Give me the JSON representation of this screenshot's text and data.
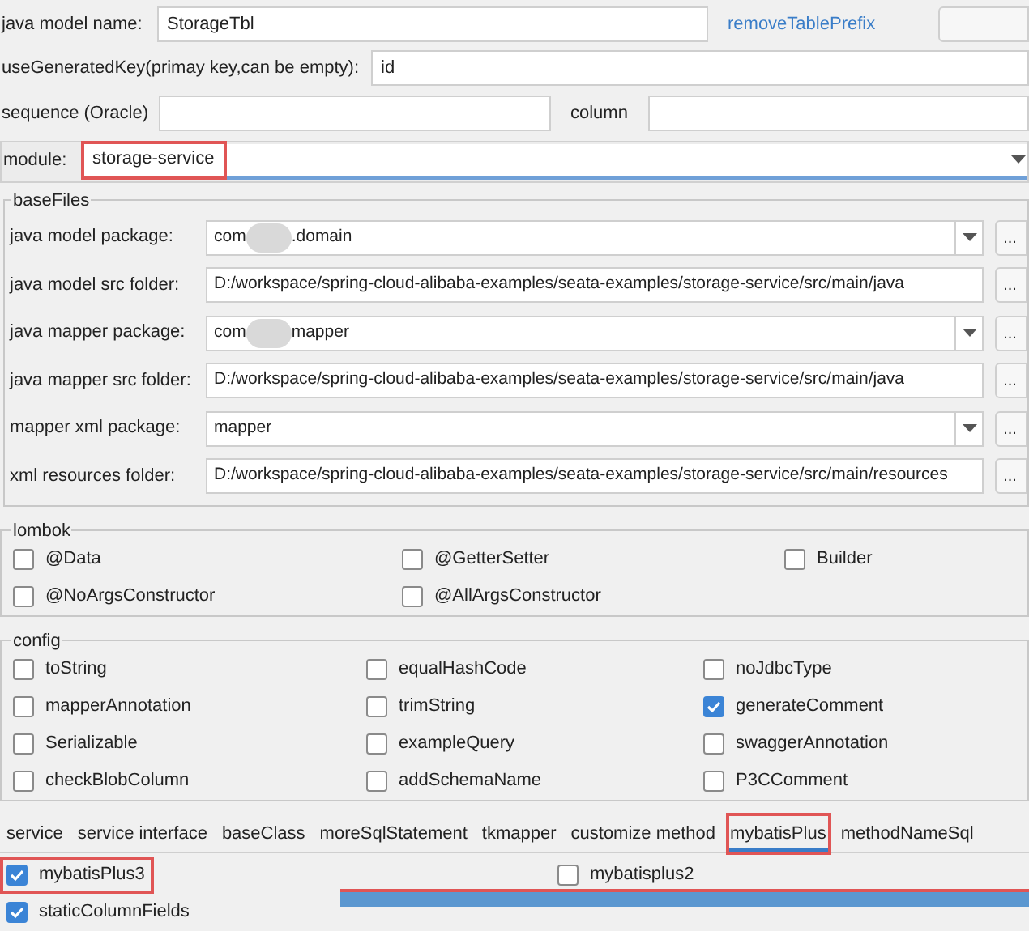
{
  "model_name": {
    "label": "java model name:",
    "value": "StorageTbl"
  },
  "remove_prefix_link": "removeTablePrefix",
  "generated_key": {
    "label": "useGeneratedKey(primay key,can be empty):",
    "value": "id"
  },
  "sequence": {
    "label": "sequence (Oracle)",
    "column_label": "column"
  },
  "module": {
    "label": "module:",
    "value": "storage-service",
    "highlighted": true
  },
  "base_files": {
    "title": "baseFiles",
    "rows": [
      {
        "label": "java model package:",
        "kind": "combo",
        "value_start": "com",
        "value_end": ".domain"
      },
      {
        "label": "java model src folder:",
        "kind": "text",
        "value_start": "D:/workspace/spring-cloud-alibaba-examples/seata-examples/storage-service/src/main/java"
      },
      {
        "label": "java mapper package:",
        "kind": "combo",
        "value_start": "com",
        "value_end": "mapper"
      },
      {
        "label": "java mapper src folder:",
        "kind": "text",
        "value_start": "D:/workspace/spring-cloud-alibaba-examples/seata-examples/storage-service/src/main/java"
      },
      {
        "label": "mapper xml package:",
        "kind": "combo",
        "value_start": "mapper"
      },
      {
        "label": "xml resources folder:",
        "kind": "text",
        "value_start": "D:/workspace/spring-cloud-alibaba-examples/seata-examples/storage-service/src/main/resources"
      }
    ],
    "browse_label": "..."
  },
  "lombok": {
    "title": "lombok",
    "options": [
      {
        "label": "@Data",
        "checked": false
      },
      {
        "label": "@GetterSetter",
        "checked": false
      },
      {
        "label": "Builder",
        "checked": false
      },
      {
        "label": "@NoArgsConstructor",
        "checked": false
      },
      {
        "label": "@AllArgsConstructor",
        "checked": false
      }
    ]
  },
  "config": {
    "title": "config",
    "options": [
      {
        "label": "toString",
        "checked": false
      },
      {
        "label": "equalHashCode",
        "checked": false
      },
      {
        "label": "noJdbcType",
        "checked": false
      },
      {
        "label": "mapperAnnotation",
        "checked": false
      },
      {
        "label": "trimString",
        "checked": false
      },
      {
        "label": "generateComment",
        "checked": true
      },
      {
        "label": "Serializable",
        "checked": false
      },
      {
        "label": "exampleQuery",
        "checked": false
      },
      {
        "label": "swaggerAnnotation",
        "checked": false
      },
      {
        "label": "checkBlobColumn",
        "checked": false
      },
      {
        "label": "addSchemaName",
        "checked": false
      },
      {
        "label": "P3CComment",
        "checked": false
      }
    ]
  },
  "tabs": [
    {
      "label": "service",
      "selected": false,
      "highlighted": false
    },
    {
      "label": "service interface",
      "selected": false,
      "highlighted": false
    },
    {
      "label": "baseClass",
      "selected": false,
      "highlighted": false
    },
    {
      "label": "moreSqlStatement",
      "selected": false,
      "highlighted": false
    },
    {
      "label": "tkmapper",
      "selected": false,
      "highlighted": false
    },
    {
      "label": "customize method",
      "selected": false,
      "highlighted": false
    },
    {
      "label": "mybatisPlus",
      "selected": true,
      "highlighted": true
    },
    {
      "label": "methodNameSql",
      "selected": false,
      "highlighted": false
    }
  ],
  "mybatis_plus_options": [
    {
      "label": "mybatisPlus3",
      "checked": true,
      "highlighted": true
    },
    {
      "label": "mybatisplus2",
      "checked": false,
      "highlighted": false
    },
    {
      "label": "staticColumnFields",
      "checked": true,
      "highlighted": false
    }
  ]
}
